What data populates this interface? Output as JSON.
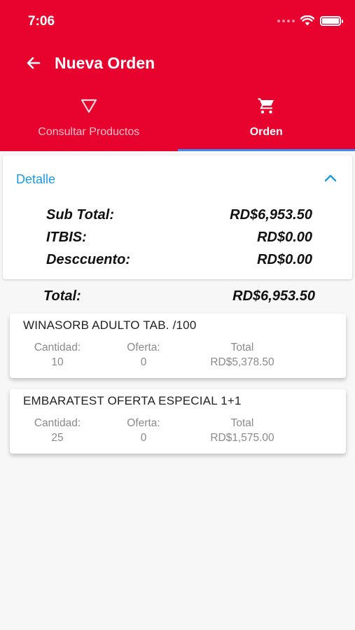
{
  "status_bar": {
    "time": "7:06"
  },
  "app_bar": {
    "title": "Nueva Orden",
    "back_icon": "arrow-left-icon"
  },
  "tabs": [
    {
      "label": "Consultar Productos",
      "icon": "filter-icon",
      "active": false
    },
    {
      "label": "Orden",
      "icon": "cart-icon",
      "active": true
    }
  ],
  "detail": {
    "title": "Detalle",
    "expanded": true,
    "rows": [
      {
        "label": "Sub Total:",
        "value": "RD$6,953.50"
      },
      {
        "label": "ITBIS:",
        "value": "RD$0.00"
      },
      {
        "label": "Desccuento:",
        "value": "RD$0.00"
      }
    ]
  },
  "total": {
    "label": "Total:",
    "value": "RD$6,953.50"
  },
  "products": [
    {
      "name": "WINASORB ADULTO TAB. /100",
      "cantidad_label": "Cantidad:",
      "cantidad": "10",
      "oferta_label": "Oferta:",
      "oferta": "0",
      "total_label": "Total",
      "total": "RD$5,378.50"
    },
    {
      "name": "EMBARATEST OFERTA ESPECIAL 1+1",
      "cantidad_label": "Cantidad:",
      "cantidad": "25",
      "oferta_label": "Oferta:",
      "oferta": "0",
      "total_label": "Total",
      "total": "RD$1,575.00"
    }
  ],
  "colors": {
    "primary": "#e8022e",
    "accent": "#1a9be6",
    "indicator": "#3d8bf2"
  }
}
